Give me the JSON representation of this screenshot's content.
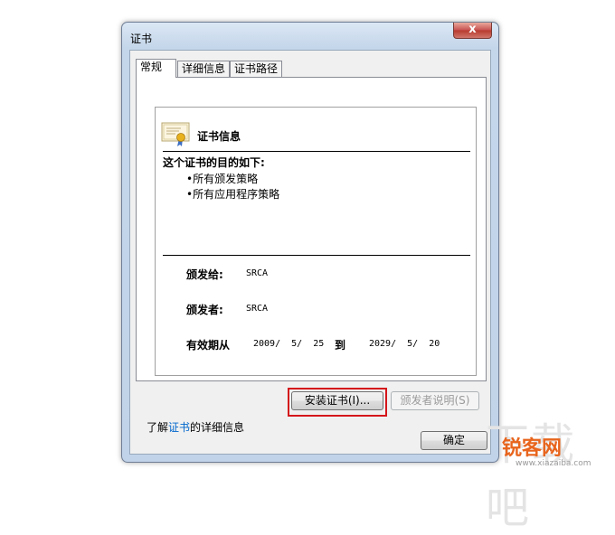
{
  "window": {
    "title": "证书",
    "close_glyph": "x"
  },
  "tabs": [
    {
      "label": "常规",
      "active": true
    },
    {
      "label": "详细信息",
      "active": false
    },
    {
      "label": "证书路径",
      "active": false
    }
  ],
  "cert_info": {
    "icon": "certificate-icon",
    "title": "证书信息",
    "purpose_title": "这个证书的目的如下:",
    "purposes": [
      "•所有颁发策略",
      "•所有应用程序策略"
    ],
    "issued_to_label": "颁发给:",
    "issued_to_value": "SRCA",
    "issued_by_label": "颁发者:",
    "issued_by_value": "SRCA",
    "validity_label": "有效期从",
    "valid_from": "2009/  5/  25",
    "to_label": "到",
    "valid_to": "2029/  5/  20"
  },
  "buttons": {
    "install": "安装证书(I)...",
    "issuer_statement": "颁发者说明(S)",
    "ok": "确定"
  },
  "learn_more": {
    "prefix": "了解",
    "link": "证书",
    "suffix": "的详细信息"
  },
  "watermark": {
    "bg_text": "下载吧",
    "logo": "锐客网",
    "url": "www.xiazaiba.com"
  },
  "colors": {
    "highlight": "#d4161b",
    "link": "#0066cc",
    "logo": "#e8651d"
  }
}
